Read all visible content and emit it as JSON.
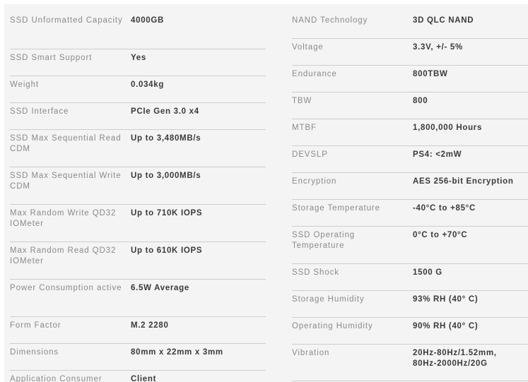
{
  "specs": {
    "left": [
      {
        "label": "SSD Unformatted Capacity",
        "value": "4000GB"
      },
      {
        "label": "SSD Smart Support",
        "value": "Yes"
      },
      {
        "label": "Weight",
        "value": "0.034kg"
      },
      {
        "label": "SSD Interface",
        "value": "PCIe Gen 3.0 x4"
      },
      {
        "label": "SSD Max Sequential Read CDM",
        "value": "Up to 3,480MB/s"
      },
      {
        "label": "SSD Max Sequential Write CDM",
        "value": "Up to 3,000MB/s"
      },
      {
        "label": "Max Random Write QD32 IOMeter",
        "value": "Up to 710K IOPS"
      },
      {
        "label": "Max Random Read QD32 IOMeter",
        "value": "Up to 610K IOPS"
      },
      {
        "label": "Power Consumption active",
        "value": "6.5W Average"
      },
      {
        "label": "Form Factor",
        "value": "M.2 2280"
      },
      {
        "label": "Dimensions",
        "value": "80mm x 22mm x 3mm"
      },
      {
        "label": "Application Consumer",
        "value": "Client"
      }
    ],
    "right": [
      {
        "label": "NAND Technology",
        "value": "3D QLC NAND"
      },
      {
        "label": "Voltage",
        "value": "3.3V, +/- 5%"
      },
      {
        "label": "Endurance",
        "value": "800TBW"
      },
      {
        "label": "TBW",
        "value": "800"
      },
      {
        "label": "MTBF",
        "value": "1,800,000 Hours"
      },
      {
        "label": "DEVSLP",
        "value": "PS4: <2mW"
      },
      {
        "label": "Encryption",
        "value": "AES 256-bit Encryption"
      },
      {
        "label": "Storage Temperature",
        "value": "-40°C to +85°C"
      },
      {
        "label": "SSD Operating Temperature",
        "value": "0°C to +70°C"
      },
      {
        "label": "SSD Shock",
        "value": "1500 G"
      },
      {
        "label": "Storage Humidity",
        "value": "93% RH (40° C)"
      },
      {
        "label": "Operating Humidity",
        "value": "90% RH (40° C)"
      },
      {
        "label": "Vibration",
        "value": "20Hz-80Hz/1.52mm,\n80Hz-2000Hz/20G"
      }
    ]
  }
}
